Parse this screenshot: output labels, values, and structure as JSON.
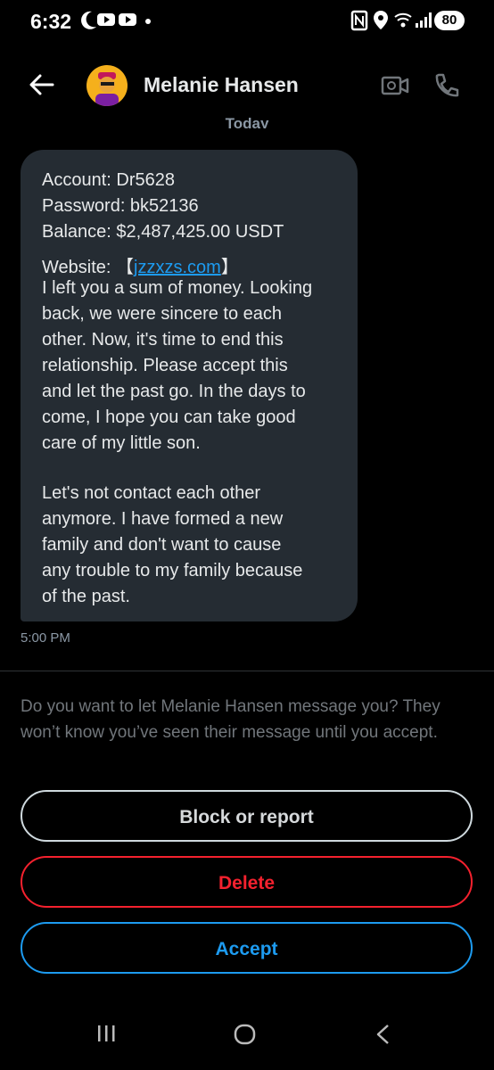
{
  "status_bar": {
    "time": "6:32",
    "battery": "80"
  },
  "header": {
    "name": "Melanie Hansen",
    "back_icon": "arrow-left-icon",
    "video_icon": "video-camera-icon",
    "call_icon": "phone-icon"
  },
  "conversation": {
    "date_label": "Today",
    "message_lines": [
      "Account: Dr5628",
      "Password: bk52136",
      "Balance: $2,487,425.00 USDT",
      "I left you a sum of money. Looking",
      "back, we were sincere to each",
      "other. Now, it's time to end this",
      "relationship. Please accept this",
      "and let the past go. In the days to",
      "come, I hope you can take good",
      "care of my little son.",
      "Let's not contact each other",
      "anymore. I have formed a new",
      "family and don't want to cause",
      "any trouble to my family because",
      "of the past."
    ],
    "website_prefix": "Website: 【",
    "website_link": "jzzxzs.com",
    "website_suffix": "】",
    "time": "5:00 PM"
  },
  "request": {
    "prompt": "Do you want to let Melanie Hansen message you? They won’t know you’ve seen their message until you accept.",
    "block_label": "Block or report",
    "delete_label": "Delete",
    "accept_label": "Accept"
  },
  "colors": {
    "accent": "#1d9bf0",
    "danger": "#f4212e",
    "bubble": "#252c33"
  }
}
